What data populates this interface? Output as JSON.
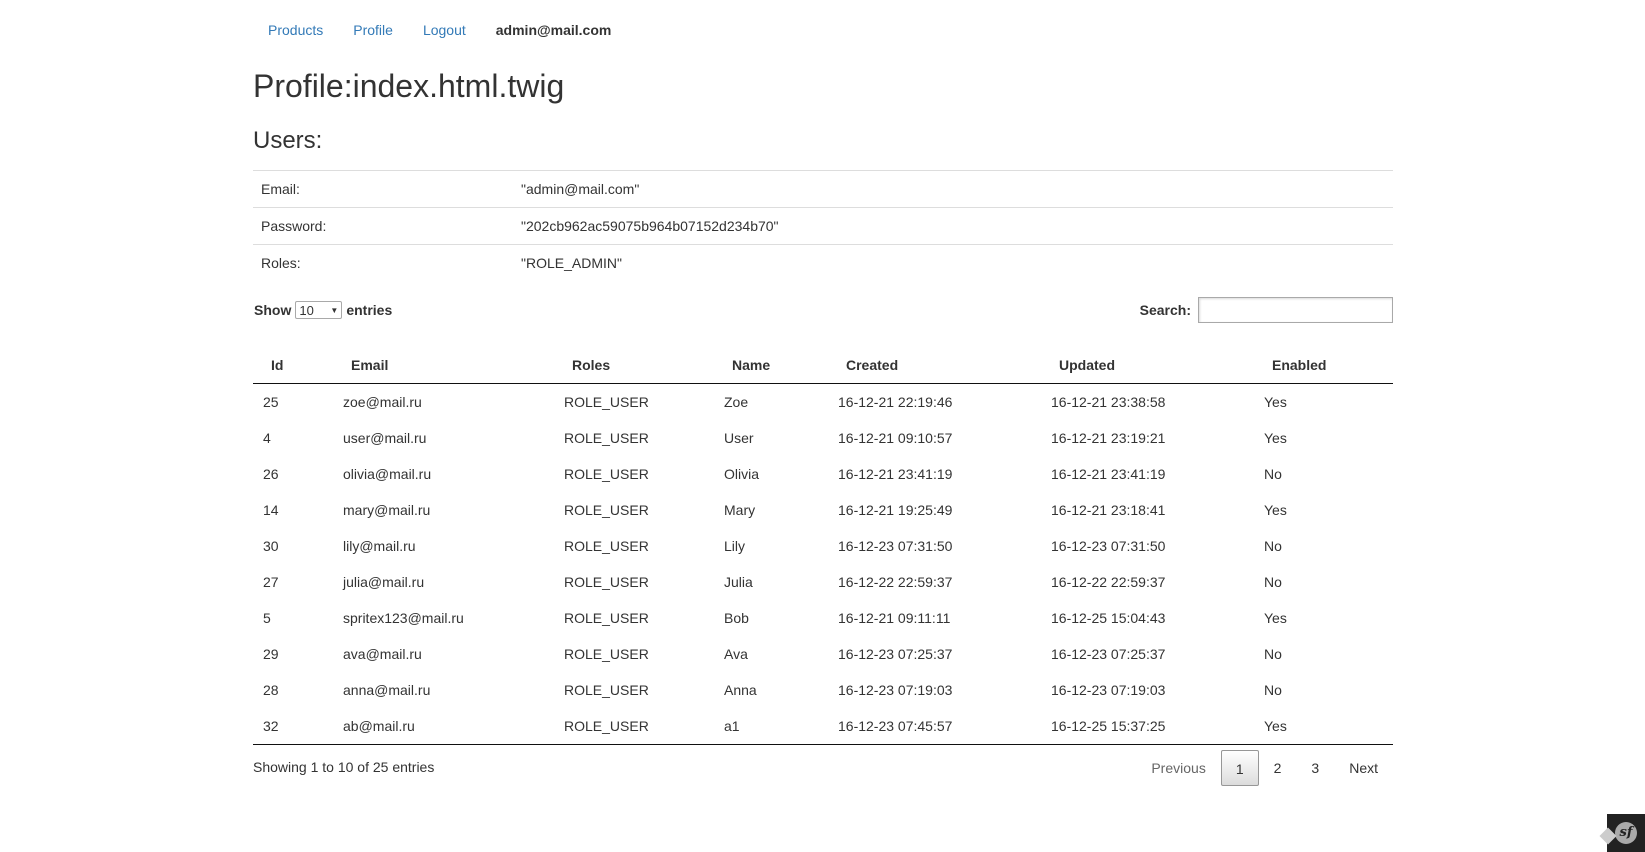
{
  "nav": {
    "products": "Products",
    "profile": "Profile",
    "logout": "Logout",
    "user": "admin@mail.com"
  },
  "page_title": "Profile:index.html.twig",
  "users_heading": "Users:",
  "profile_info": [
    {
      "label": "Email:",
      "value": "\"admin@mail.com\""
    },
    {
      "label": "Password:",
      "value": "\"202cb962ac59075b964b07152d234b70\""
    },
    {
      "label": "Roles:",
      "value": "\"ROLE_ADMIN\""
    }
  ],
  "length_menu": {
    "show": "Show",
    "value": "10",
    "entries": "entries"
  },
  "search": {
    "label": "Search:",
    "value": ""
  },
  "table": {
    "columns": [
      "Id",
      "Email",
      "Roles",
      "Name",
      "Created",
      "Updated",
      "Enabled"
    ],
    "rows": [
      [
        "25",
        "zoe@mail.ru",
        "ROLE_USER",
        "Zoe",
        "16-12-21 22:19:46",
        "16-12-21 23:38:58",
        "Yes"
      ],
      [
        "4",
        "user@mail.ru",
        "ROLE_USER",
        "User",
        "16-12-21 09:10:57",
        "16-12-21 23:19:21",
        "Yes"
      ],
      [
        "26",
        "olivia@mail.ru",
        "ROLE_USER",
        "Olivia",
        "16-12-21 23:41:19",
        "16-12-21 23:41:19",
        "No"
      ],
      [
        "14",
        "mary@mail.ru",
        "ROLE_USER",
        "Mary",
        "16-12-21 19:25:49",
        "16-12-21 23:18:41",
        "Yes"
      ],
      [
        "30",
        "lily@mail.ru",
        "ROLE_USER",
        "Lily",
        "16-12-23 07:31:50",
        "16-12-23 07:31:50",
        "No"
      ],
      [
        "27",
        "julia@mail.ru",
        "ROLE_USER",
        "Julia",
        "16-12-22 22:59:37",
        "16-12-22 22:59:37",
        "No"
      ],
      [
        "5",
        "spritex123@mail.ru",
        "ROLE_USER",
        "Bob",
        "16-12-21 09:11:11",
        "16-12-25 15:04:43",
        "Yes"
      ],
      [
        "29",
        "ava@mail.ru",
        "ROLE_USER",
        "Ava",
        "16-12-23 07:25:37",
        "16-12-23 07:25:37",
        "No"
      ],
      [
        "28",
        "anna@mail.ru",
        "ROLE_USER",
        "Anna",
        "16-12-23 07:19:03",
        "16-12-23 07:19:03",
        "No"
      ],
      [
        "32",
        "ab@mail.ru",
        "ROLE_USER",
        "a1",
        "16-12-23 07:45:57",
        "16-12-25 15:37:25",
        "Yes"
      ]
    ]
  },
  "footer": {
    "info": "Showing 1 to 10 of 25 entries",
    "pagination": {
      "previous": "Previous",
      "pages": [
        "1",
        "2",
        "3"
      ],
      "current": "1",
      "next": "Next"
    }
  },
  "toolbar": {
    "icon": "symfony-logo-icon",
    "glyph": "sf"
  }
}
